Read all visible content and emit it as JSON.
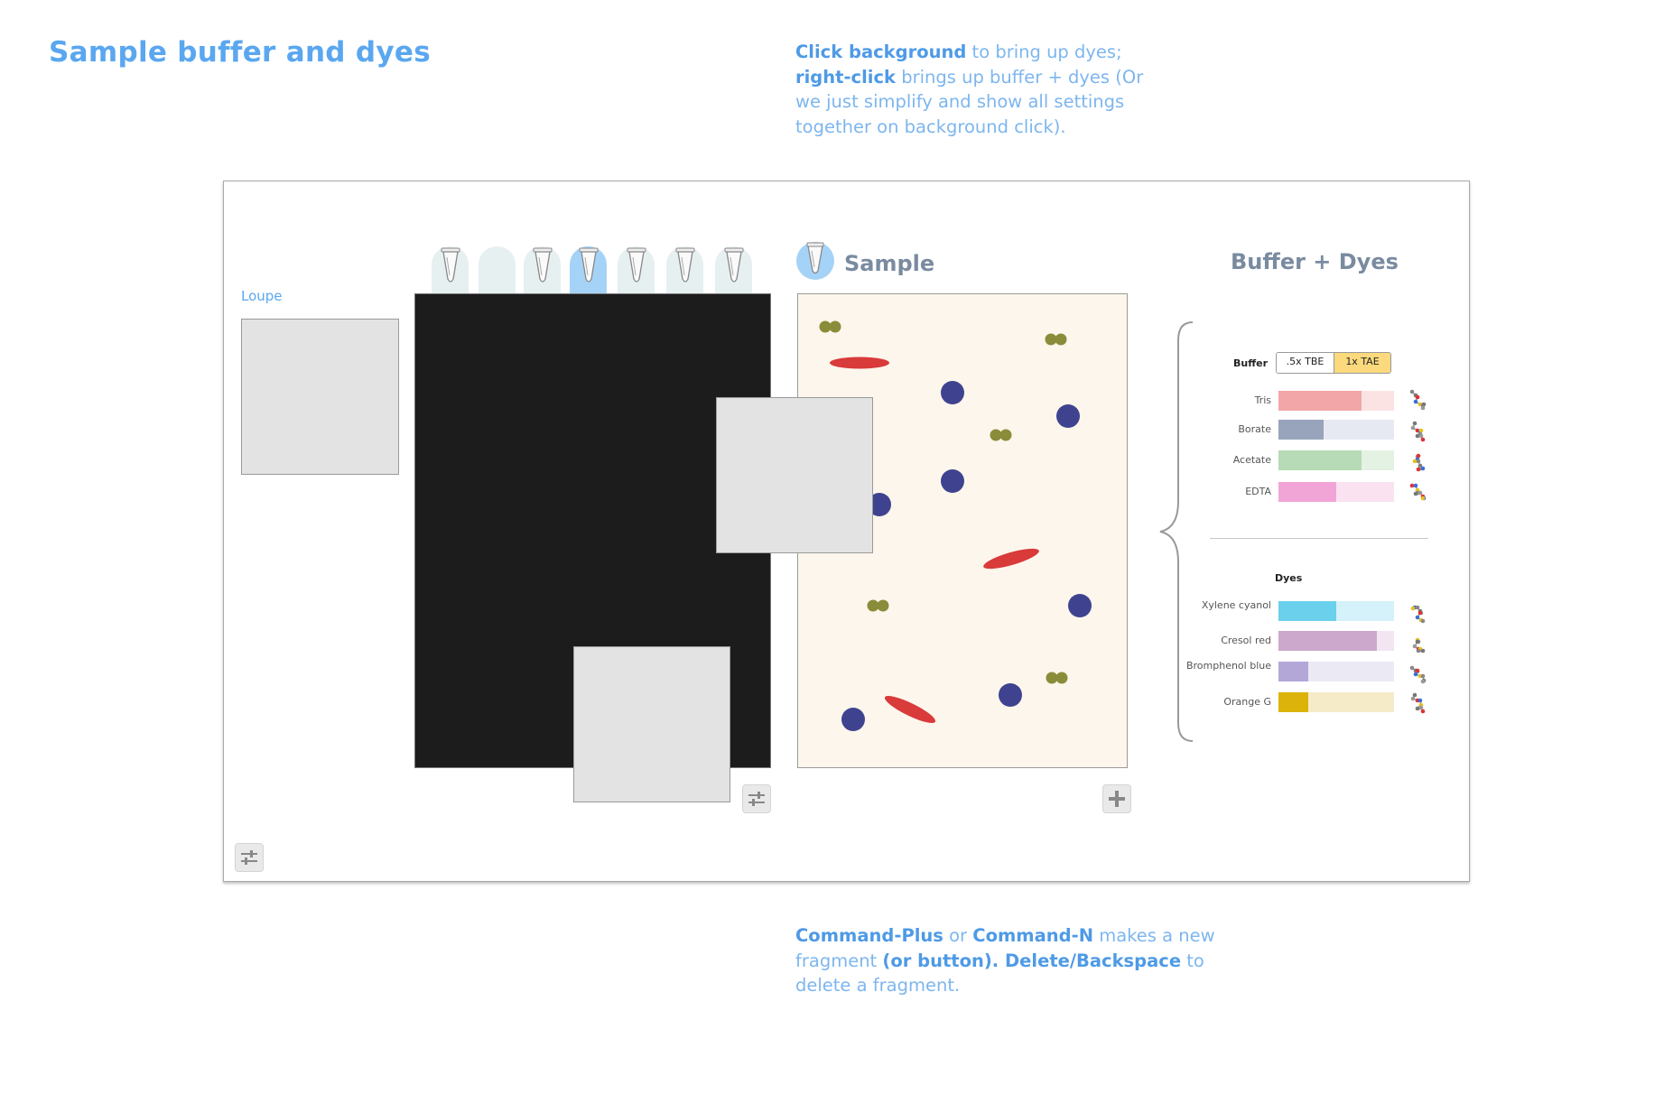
{
  "page": {
    "title": "Sample buffer and dyes"
  },
  "notes": {
    "top": [
      {
        "text": "Click background",
        "bold": true
      },
      {
        "text": " to bring up dyes; ",
        "bold": false
      },
      {
        "text": "right-click",
        "bold": true
      },
      {
        "text": " brings up buffer + dyes (Or we just simplify and show all settings together on background click).",
        "bold": false
      }
    ],
    "bottom": [
      {
        "text": "Command-Plus",
        "bold": true
      },
      {
        "text": " or ",
        "bold": false
      },
      {
        "text": "Command-N",
        "bold": true
      },
      {
        "text": " makes a new fragment ",
        "bold": false
      },
      {
        "text": "(or button). Delete/Backspace",
        "bold": true
      },
      {
        "text": " to delete a fragment.",
        "bold": false
      }
    ]
  },
  "loupe": {
    "label": "Loupe"
  },
  "wells": {
    "count": 7,
    "active_index": 3,
    "tube_wells": [
      0,
      2,
      3,
      4,
      5,
      6
    ]
  },
  "sample": {
    "title": "Sample"
  },
  "buffer_dyes": {
    "title": "Buffer + Dyes",
    "buffer_label": "Buffer",
    "buffer_options": [
      ".5x TBE",
      "1x TAE"
    ],
    "buffer_selected": "1x TAE",
    "components": [
      {
        "name": "Tris",
        "level": 0.72,
        "color": "#f2a6a8",
        "track": "#fbe3e4"
      },
      {
        "name": "Borate",
        "level": 0.39,
        "color": "#97a4bb",
        "track": "#e6e9f1"
      },
      {
        "name": "Acetate",
        "level": 0.72,
        "color": "#b6dbb6",
        "track": "#e3f2e3"
      },
      {
        "name": "EDTA",
        "level": 0.5,
        "color": "#f0a5d6",
        "track": "#fbe2f1"
      }
    ],
    "dyes_label": "Dyes",
    "dyes": [
      {
        "name": "Xylene cyanol",
        "level": 0.5,
        "color": "#6ad0ec",
        "track": "#d5f1f9"
      },
      {
        "name": "Cresol red",
        "level": 0.85,
        "color": "#cca9cc",
        "track": "#f2e6f2"
      },
      {
        "name": "Bromphenol blue",
        "level": 0.26,
        "color": "#b3a7d8",
        "track": "#ebe9f4"
      },
      {
        "name": "Orange G",
        "level": 0.26,
        "color": "#dcb30a",
        "track": "#f6ebc8"
      }
    ]
  },
  "colors": {
    "accent": "#5aa7f0",
    "gel": "#1c1c1c",
    "sample_bg": "#fdf6ec",
    "blue_molecule": "#3f438f",
    "red_molecule": "#d93a3a",
    "olive_molecule": "#8b8c3a",
    "selected_buffer": "#fbd97c"
  },
  "icons": {
    "settings": "sliders-icon",
    "add": "plus-icon",
    "tube": "microtube-icon",
    "molecule": "molecule-structure-icon"
  }
}
